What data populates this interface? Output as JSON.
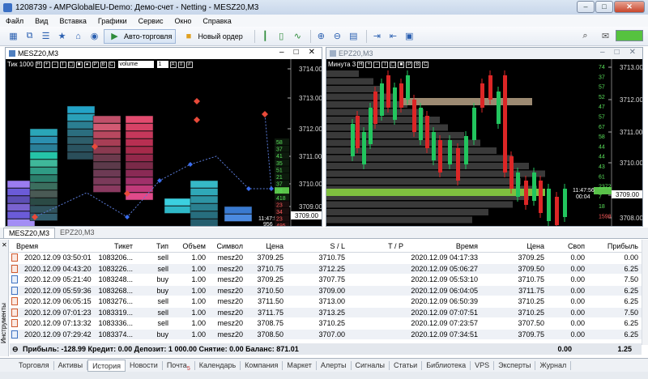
{
  "window": {
    "title": "1208739 - AMPGlobalEU-Demo: Демо-счет - Netting - MESZ20,M3"
  },
  "menu": [
    "Файл",
    "Вид",
    "Вставка",
    "Графики",
    "Сервис",
    "Окно",
    "Справка"
  ],
  "toolbar": {
    "autotrade": "Авто-торговля",
    "new_order": "Новый ордер"
  },
  "chart_left": {
    "title": "MESZ20,M3",
    "tick_label": "Тик 1000",
    "volume_select": "volume",
    "num_select": "1",
    "prices": [
      "3714.00",
      "3713.00",
      "3712.00",
      "3711.00",
      "3710.00",
      "3709.00"
    ],
    "current_price": "3709.00",
    "time": "11:47:56",
    "time_sub": "956",
    "right_vols": [
      "58",
      "37",
      "41",
      "35",
      "51",
      "21",
      "37",
      "78",
      "418",
      "23",
      "34",
      "23",
      "495"
    ]
  },
  "chart_right": {
    "title": "EPZ20,M3",
    "label": "Минута 3",
    "prices": [
      "3713.00",
      "3712.00",
      "3711.00",
      "3710.00",
      "3709.00",
      "3708.00"
    ],
    "current_price": "3709.00",
    "time": "11:47:56",
    "time_sub": "00:04",
    "vols": [
      "74",
      "37",
      "57",
      "52",
      "47",
      "57",
      "67",
      "58",
      "44",
      "44",
      "43",
      "61",
      "2372",
      "7",
      "18",
      "1598"
    ]
  },
  "chart_tabs": [
    "MESZ20,M3",
    "EPZ20,M3"
  ],
  "table": {
    "headers": [
      "Время",
      "Тикет",
      "Тип",
      "Объем",
      "Символ",
      "Цена",
      "S / L",
      "T / P",
      "Время",
      "Цена",
      "Своп",
      "Прибыль"
    ],
    "rows": [
      [
        "2020.12.09 03:50:01",
        "1083206...",
        "sell",
        "1.00",
        "mesz20",
        "3709.25",
        "3710.75",
        "",
        "2020.12.09 04:17:33",
        "3709.25",
        "0.00",
        "0.00"
      ],
      [
        "2020.12.09 04:43:20",
        "1083226...",
        "sell",
        "1.00",
        "mesz20",
        "3710.75",
        "3712.25",
        "",
        "2020.12.09 05:06:27",
        "3709.50",
        "0.00",
        "6.25"
      ],
      [
        "2020.12.09 05:21:40",
        "1083248...",
        "buy",
        "1.00",
        "mesz20",
        "3709.25",
        "3707.75",
        "",
        "2020.12.09 05:53:10",
        "3710.75",
        "0.00",
        "7.50"
      ],
      [
        "2020.12.09 05:59:36",
        "1083268...",
        "buy",
        "1.00",
        "mesz20",
        "3710.50",
        "3709.00",
        "",
        "2020.12.09 06:04:05",
        "3711.75",
        "0.00",
        "6.25"
      ],
      [
        "2020.12.09 06:05:15",
        "1083276...",
        "sell",
        "1.00",
        "mesz20",
        "3711.50",
        "3713.00",
        "",
        "2020.12.09 06:50:39",
        "3710.25",
        "0.00",
        "6.25"
      ],
      [
        "2020.12.09 07:01:23",
        "1083319...",
        "sell",
        "1.00",
        "mesz20",
        "3711.75",
        "3713.25",
        "",
        "2020.12.09 07:07:51",
        "3710.25",
        "0.00",
        "7.50"
      ],
      [
        "2020.12.09 07:13:32",
        "1083336...",
        "sell",
        "1.00",
        "mesz20",
        "3708.75",
        "3710.25",
        "",
        "2020.12.09 07:23:57",
        "3707.50",
        "0.00",
        "6.25"
      ],
      [
        "2020.12.09 07:29:42",
        "1083374...",
        "buy",
        "1.00",
        "mesz20",
        "3708.50",
        "3707.00",
        "",
        "2020.12.09 07:34:51",
        "3709.75",
        "0.00",
        "6.25"
      ]
    ],
    "summary": "Прибыль: -128.99  Кредит: 0.00  Депозит: 1 000.00  Снятие: 0.00  Баланс: 871.01",
    "summary_swap": "0.00",
    "summary_profit": "1.25"
  },
  "side_label": "Инструменты",
  "bottom_tabs": [
    "Торговля",
    "Активы",
    "История",
    "Новости",
    "Почта",
    "Календарь",
    "Компания",
    "Маркет",
    "Алерты",
    "Сигналы",
    "Статьи",
    "Библиотека",
    "VPS",
    "Эксперты",
    "Журнал"
  ],
  "mail_badge": "5",
  "colors": {
    "accent": "#3a6fc4",
    "bull": "#22c55e",
    "bear": "#dc2626",
    "highlight": "#7fbf3f"
  }
}
